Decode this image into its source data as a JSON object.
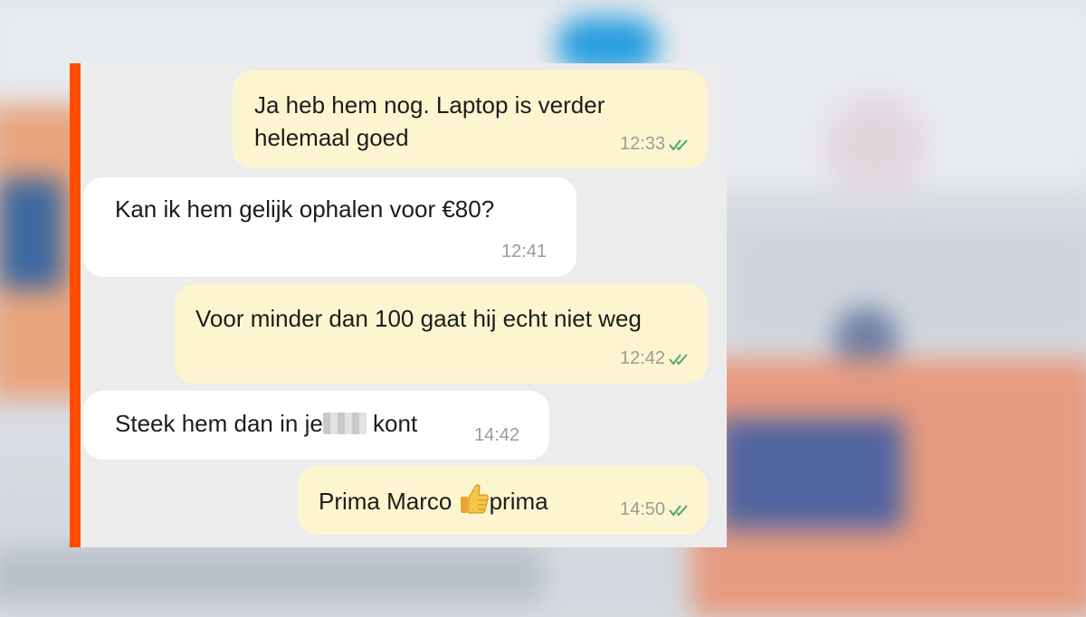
{
  "messages": [
    {
      "direction": "outgoing",
      "text": "Ja heb hem nog. Laptop is verder helemaal goed",
      "time": "12:33",
      "status": "read-double-check"
    },
    {
      "direction": "incoming",
      "text": "Kan ik hem gelijk ophalen voor €80?",
      "time": "12:41"
    },
    {
      "direction": "outgoing",
      "text": "Voor minder dan 100 gaat hij echt niet weg",
      "time": "12:42",
      "status": "read-double-check"
    },
    {
      "direction": "incoming",
      "text_before": "Steek hem dan in je",
      "text_after": "kont",
      "censored": true,
      "time": "14:42"
    },
    {
      "direction": "outgoing",
      "text_before": "Prima Marco",
      "text_after": "prima",
      "emoji": "thumbs-up",
      "time": "14:50",
      "status": "read-double-check"
    }
  ],
  "colors": {
    "accent_bar": "#ff4c00",
    "outgoing_bubble": "#fdf5cf",
    "incoming_bubble": "#ffffff",
    "check_marks": "#4aa96c",
    "panel_background": "#ececec"
  }
}
